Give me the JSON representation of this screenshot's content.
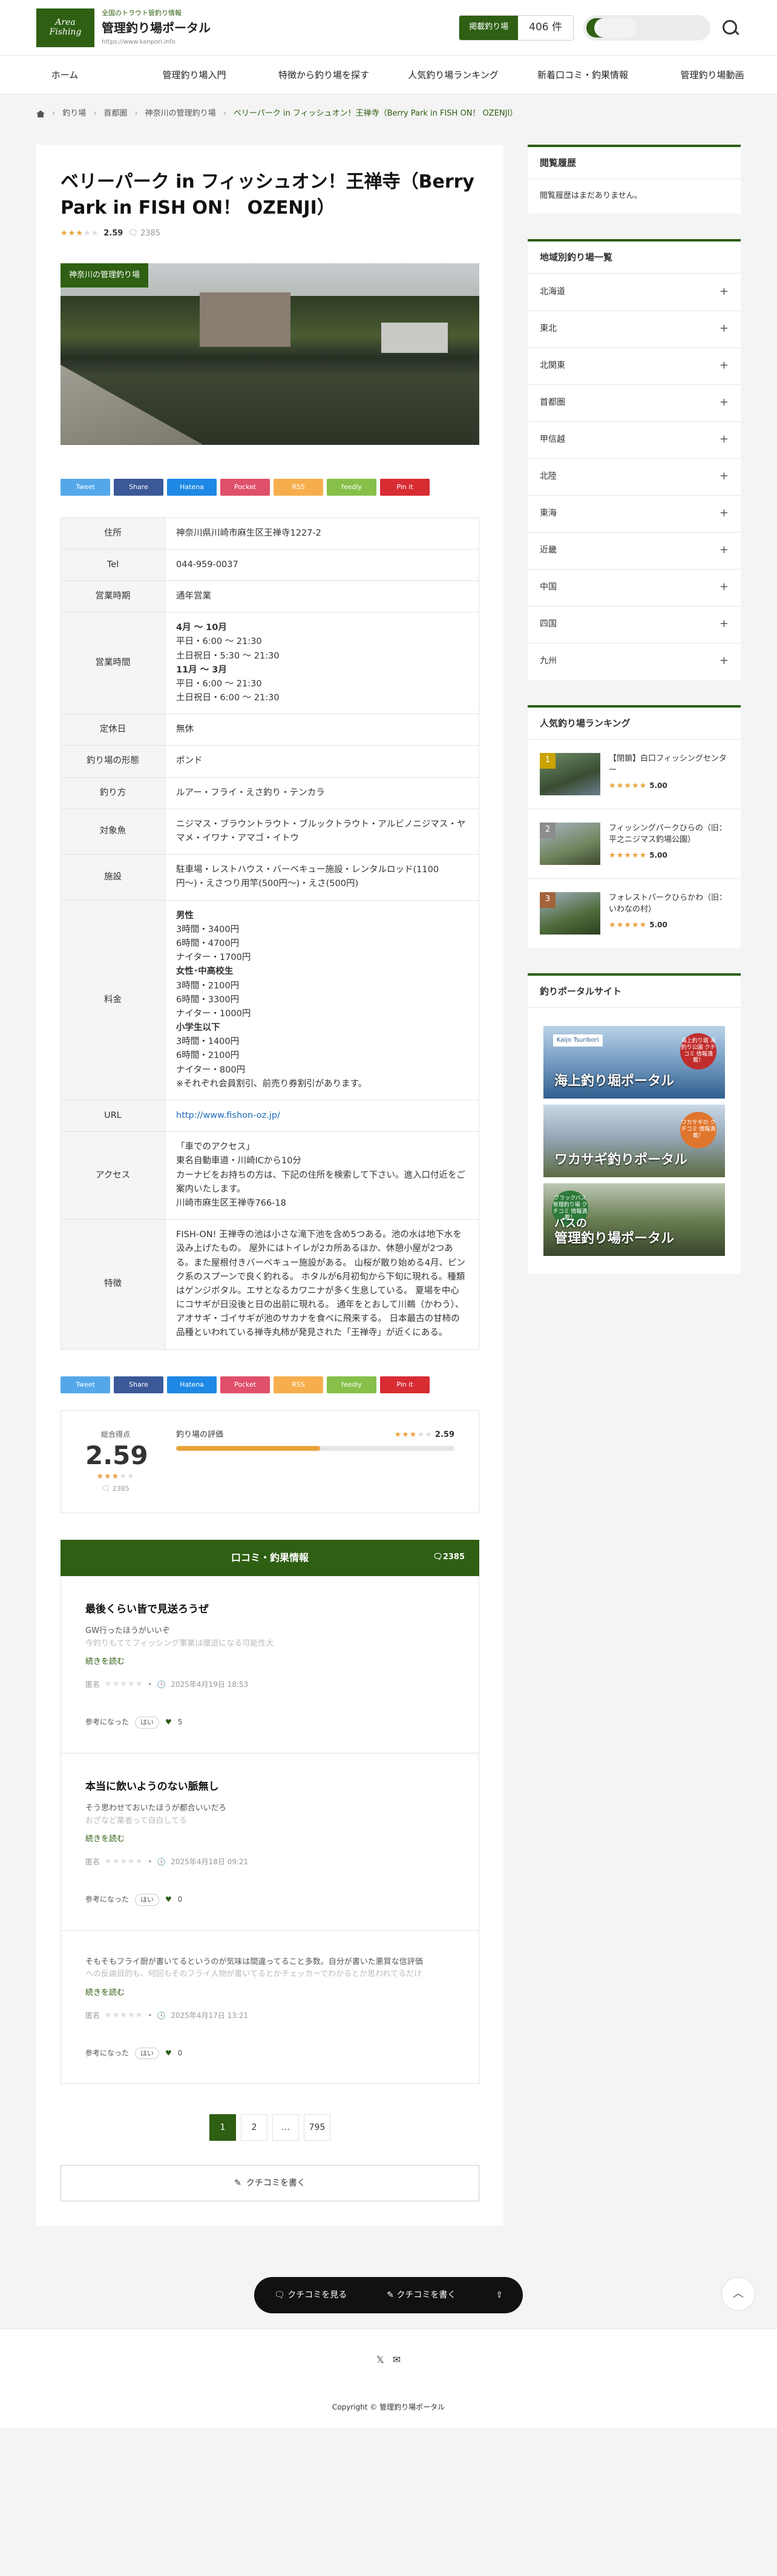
{
  "header": {
    "tagline": "全国のトラウト管釣り情報",
    "site_name": "管理釣り場ポータル",
    "site_url": "https://www.kanpori.info",
    "logo_line1": "Area",
    "logo_line2": "Fishing",
    "count_label": "掲載釣り場",
    "count_value": "406 件"
  },
  "nav": [
    "ホーム",
    "管理釣り場入門",
    "特徴から釣り場を探す",
    "人気釣り場ランキング",
    "新着口コミ・釣果情報",
    "管理釣り場動画"
  ],
  "breadcrumb": [
    "釣り場",
    "首都圏",
    "神奈川の管理釣り場",
    "ベリーパーク in フィッシュオン！王禅寺（Berry Park in FISH ON！ OZENJI）"
  ],
  "article": {
    "title": "ベリーパーク in フィッシュオン！王禅寺（Berry Park in FISH ON！ OZENJI）",
    "rating": "2.59",
    "rating_value": 2.59,
    "comment_count": "2385",
    "hero_tag": "神奈川の管理釣り場"
  },
  "share": [
    "Tweet",
    "Share",
    "Hatena",
    "Pocket",
    "RSS",
    "feedly",
    "Pin it"
  ],
  "spec": {
    "address_label": "住所",
    "address": "神奈川県川崎市麻生区王禅寺1227-2",
    "tel_label": "Tel",
    "tel": "044-959-0037",
    "season_label": "営業時期",
    "season": "通年営業",
    "hours_label": "営業時間",
    "hours_h1": "4月 〜 10月",
    "hours_1a": "平日・6:00 〜 21:30",
    "hours_1b": "土日祝日・5:30 〜 21:30",
    "hours_h2": "11月 〜 3月",
    "hours_2a": "平日・6:00 〜 21:30",
    "hours_2b": "土日祝日・6:00 〜 21:30",
    "closed_label": "定休日",
    "closed": "無休",
    "type_label": "釣り場の形態",
    "type": "ポンド",
    "method_label": "釣り方",
    "method": "ルアー・フライ・えさ釣り・テンカラ",
    "fish_label": "対象魚",
    "fish": "ニジマス・ブラウントラウト・ブルックトラウト・アルビノニジマス・ヤマメ・イワナ・アマゴ・イトウ",
    "facility_label": "施設",
    "facility": "駐車場・レストハウス・バーベキュー施設・レンタルロッド(1100円〜)・えさつり用竿(500円〜)・えさ(500円)",
    "price_label": "料金",
    "price_h1": "男性",
    "price_1a": "3時間・3400円",
    "price_1b": "6時間・4700円",
    "price_1c": "ナイター・1700円",
    "price_h2": "女性･中高校生",
    "price_2a": "3時間・2100円",
    "price_2b": "6時間・3300円",
    "price_2c": "ナイター・1000円",
    "price_h3": "小学生以下",
    "price_3a": "3時間・1400円",
    "price_3b": "6時間・2100円",
    "price_3c": "ナイター・800円",
    "price_note": "※それぞれ会員割引、前売り券割引があります。",
    "url_label": "URL",
    "url": "http://www.fishon-oz.jp/",
    "access_label": "アクセス",
    "access_1": "「車でのアクセス」",
    "access_2": "東名自動車道・川崎ICから10分",
    "access_3": "カーナビをお持ちの方は、下記の住所を検索して下さい。進入口付近をご案内いたします。",
    "access_4": "川崎市麻生区王禅寺766-18",
    "feature_label": "特徴",
    "feature": "FISH-ON! 王禅寺の池は小さな滝下池を含め5つある。池の水は地下水を汲み上げたもの。 屋外にはトイレが2カ所あるほか、休憩小屋が2つある。また屋根付きバーベキュー施設がある。 山桜が散り始める4月、ピンク系のスプーンで良く釣れる。 ホタルが6月初旬から下旬に現れる。種類はゲンジボタル。エサとなるカワニナが多く生息している。 夏場を中心にコサギが日没後と日の出前に現れる。 通年をとおして川鵜（かわう）、アオサギ・ゴイサギが池のサカナを食べに飛来する。 日本最古の甘柿の品種といわれている禅寺丸柿が発見された「王禅寺」が近くにある。"
  },
  "score": {
    "total_label": "総合得点",
    "total": "2.59",
    "count": "2385",
    "eval_label": "釣り場の評価",
    "eval_score": "2.59",
    "fill_fraction": 0.518
  },
  "reviews": {
    "header": "口コミ・釣果情報",
    "count": "2385",
    "more_label": "続きを読む",
    "helpful_label": "参考になった",
    "yes_label": "はい",
    "items": [
      {
        "title": "最後くらい皆で見送ろうぜ",
        "line1": "GW行ったほうがいいぞ",
        "line2": "今釣りもててフィッシング事業は徹退になる可能性大",
        "author": "匿名",
        "date": "2025年4月19日 18:53",
        "likes": "5"
      },
      {
        "title": "本当に飲いようのない脈無し",
        "line1": "そう思わせておいたほうが都合いいだろ",
        "line2": "おざなど業者って自白してる",
        "author": "匿名",
        "date": "2025年4月18日 09:21",
        "likes": "0"
      },
      {
        "title": "",
        "line1": "そもそもフライ厨が書いてるというのが気味は間違ってること多数。自分が書いた悪質な信評価",
        "line2": "への反論目的も、何回もそのフライ人物が書いてるとかチェッカーでわかるとか思われてるだけ",
        "author": "匿名",
        "date": "2025年4月17日 13:21",
        "likes": "0"
      }
    ]
  },
  "pager": [
    "1",
    "2",
    "…",
    "795"
  ],
  "write_label": "クチコミを書く",
  "float": {
    "view": "クチコミを見る",
    "write": "クチコミを書く"
  },
  "sidebar": {
    "history_title": "閲覧履歴",
    "history_empty": "閲覧履歴はまだありません。",
    "region_title": "地域別釣り場一覧",
    "regions": [
      "北海道",
      "東北",
      "北関東",
      "首都圏",
      "甲信越",
      "北陸",
      "東海",
      "近畿",
      "中国",
      "四国",
      "九州"
    ],
    "ranking_title": "人気釣り場ランキング",
    "ranking": [
      {
        "num": "1",
        "name": "【閉鎖】白口フィッシングセンター",
        "score": "5.00"
      },
      {
        "num": "2",
        "name": "フィッシングパークひらの（旧：平之ニジマス釣場公園）",
        "score": "5.00"
      },
      {
        "num": "3",
        "name": "フォレストパークひらかわ（旧：いわなの村）",
        "score": "5.00"
      }
    ],
    "portal_title": "釣りポータルサイト",
    "banners": [
      {
        "title": "海上釣り堀ポータル",
        "badge": "海上釣り堀 海釣り公園 クチコミ 情報満載！",
        "sub": "Kaijo Tsuribori"
      },
      {
        "title": "ワカサギ釣りポータル",
        "badge": "ワカサギの クチコミ 情報満載！"
      },
      {
        "title": "管理釣り場ポータル",
        "badge": "ブラックバス 管理釣り場 クチコミ 情報満載！",
        "prefix": "バスの"
      }
    ]
  },
  "footer": {
    "copyright": "Copyright © 管理釣り場ポータル"
  }
}
